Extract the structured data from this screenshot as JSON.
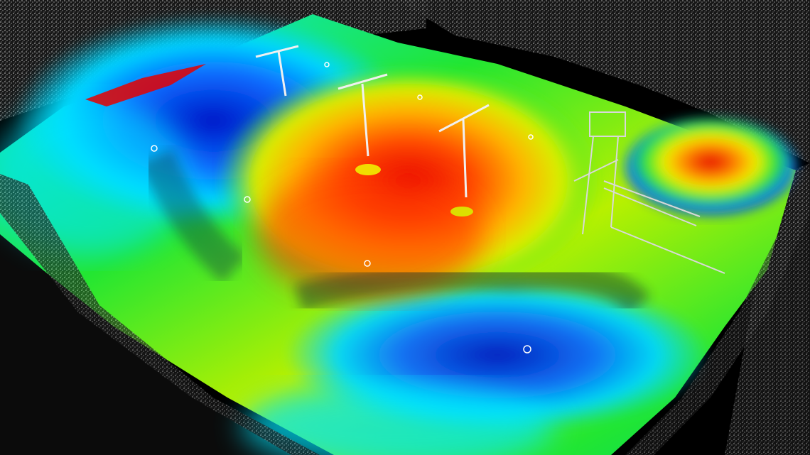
{
  "scene": {
    "description_free": true,
    "colors": {
      "background": "#000000",
      "point_cloud": "#d9d9d9",
      "elevation_low": "#0018c8",
      "elevation_mid_low": "#00e6ff",
      "elevation_mid": "#22e632",
      "elevation_mid_high": "#f0f000",
      "elevation_high": "#e60000"
    },
    "icons": [
      "survey-pole-icon",
      "conveyor-structure-icon",
      "target-marker-icon"
    ]
  }
}
